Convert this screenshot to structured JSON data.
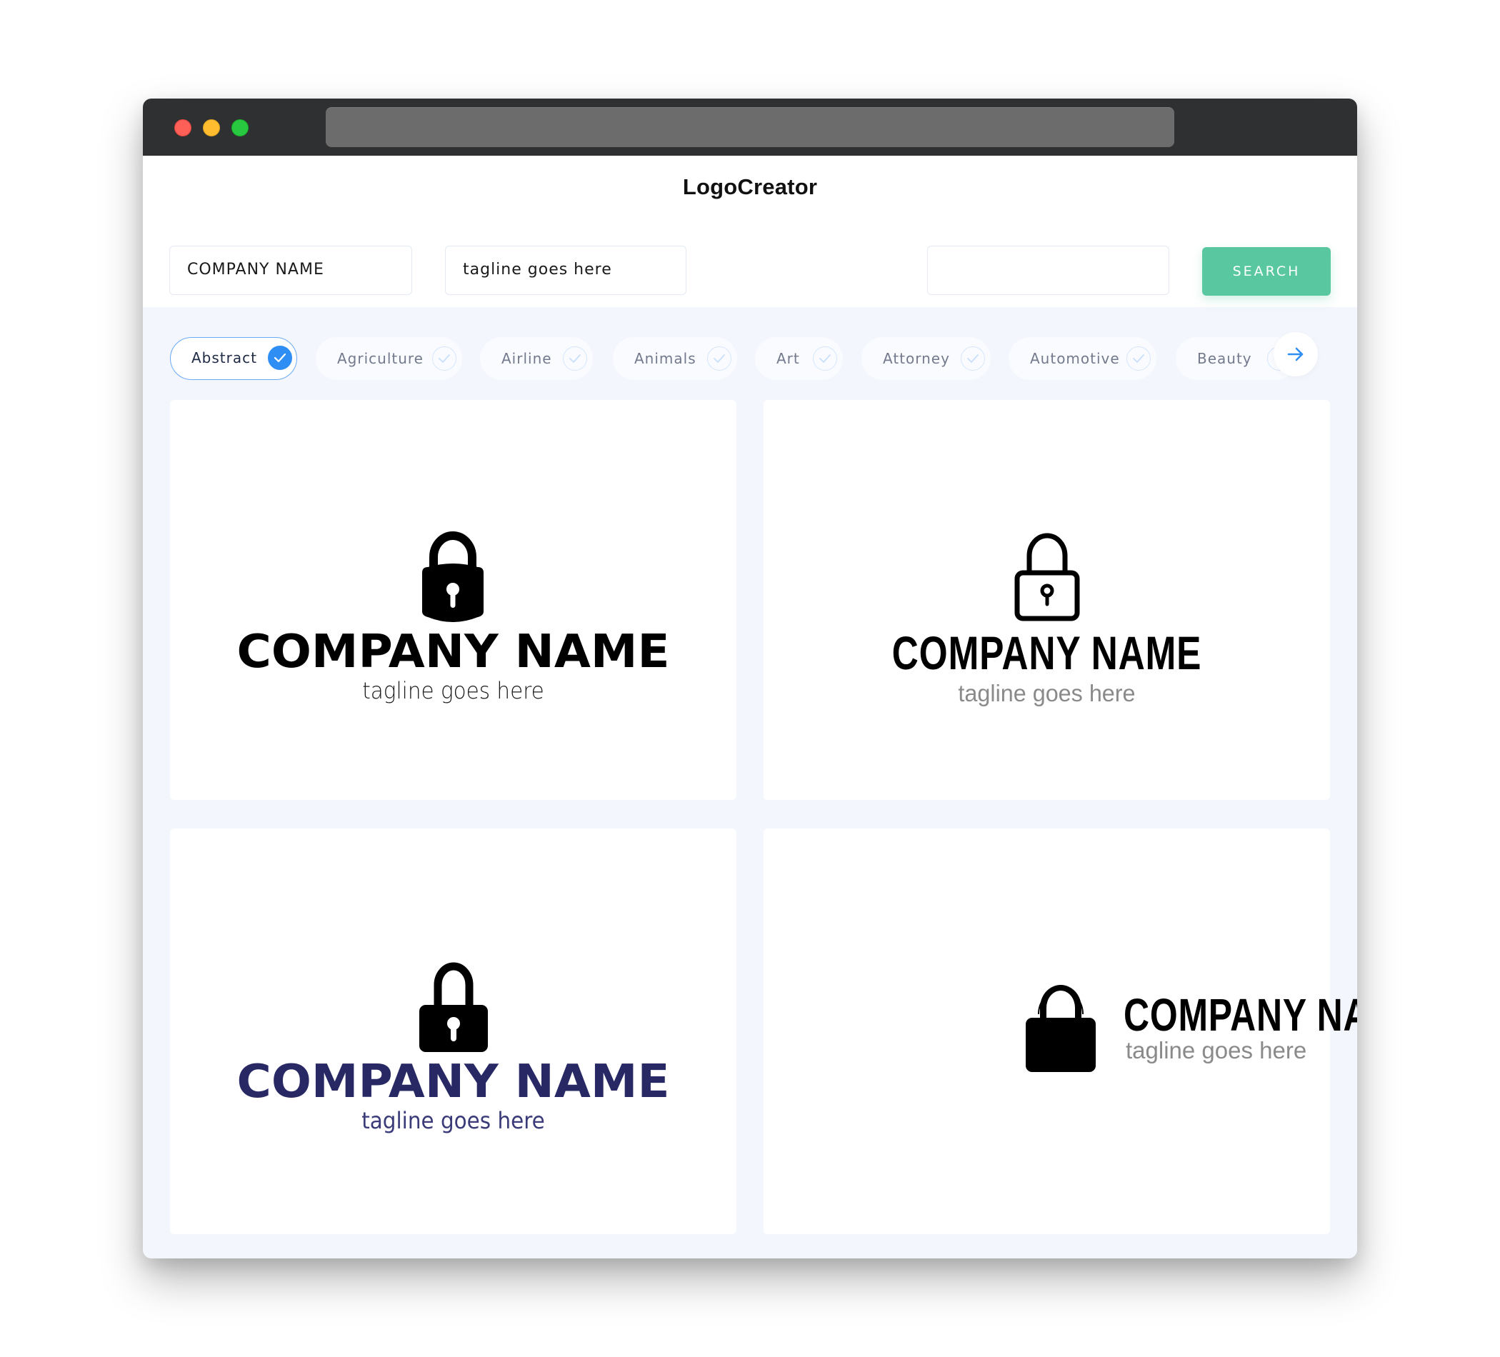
{
  "window": {
    "controls": [
      "close",
      "minimize",
      "maximize"
    ],
    "address_bar": ""
  },
  "header": {
    "app_title": "LogoCreator"
  },
  "search": {
    "company_name_value": "COMPANY NAME",
    "tagline_value": "tagline goes here",
    "keyword_value": "",
    "search_label": "SEARCH"
  },
  "filters": {
    "categories": [
      {
        "label": "Abstract",
        "selected": true
      },
      {
        "label": "Agriculture",
        "selected": false
      },
      {
        "label": "Airline",
        "selected": false
      },
      {
        "label": "Animals",
        "selected": false
      },
      {
        "label": "Art",
        "selected": false
      },
      {
        "label": "Attorney",
        "selected": false
      },
      {
        "label": "Automotive",
        "selected": false
      },
      {
        "label": "Beauty",
        "selected": false
      }
    ],
    "next_icon": "arrow-right-icon"
  },
  "colors": {
    "accent_green": "#59c8a0",
    "accent_blue": "#2f8ef3",
    "navy": "#272864"
  },
  "logos": [
    {
      "icon": "padlock-solid-icon",
      "company": "COMPANY NAME",
      "tagline": "tagline goes here",
      "color": "#000000"
    },
    {
      "icon": "padlock-outline-icon",
      "company": "COMPANY NAME",
      "tagline": "tagline goes here",
      "color": "#000000"
    },
    {
      "icon": "padlock-solid-icon",
      "company": "COMPANY NAME",
      "tagline": "tagline goes here",
      "color": "#272864"
    },
    {
      "icon": "padlock-filled-icon",
      "company": "COMPANY NAME",
      "tagline": "tagline goes here",
      "color": "#000000"
    }
  ]
}
